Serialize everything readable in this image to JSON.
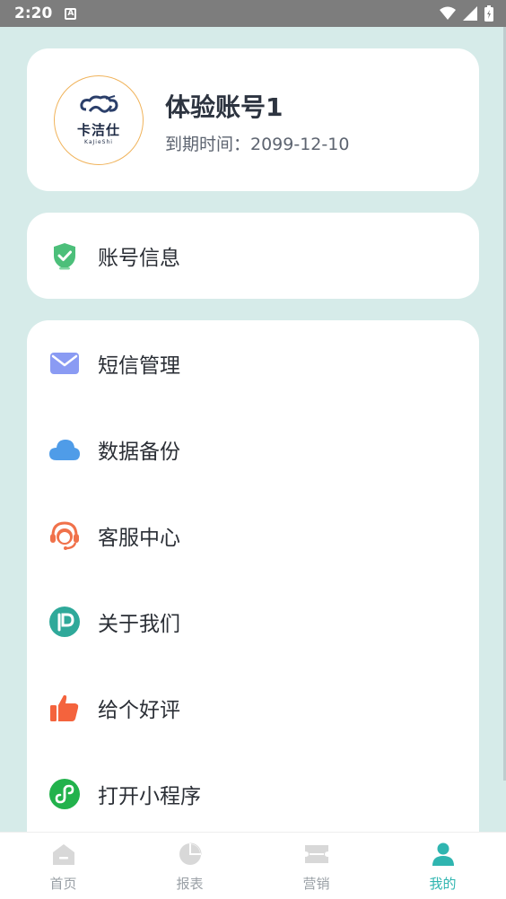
{
  "statusbar": {
    "time": "2:20",
    "a_icon": "A"
  },
  "profile": {
    "name": "体验账号1",
    "expire": "到期时间：2099-12-10",
    "brand_cn": "卡洁仕",
    "brand_en": "KaJieShi"
  },
  "account": {
    "label": "账号信息",
    "icon": "shield-check-icon",
    "color": "#4cbf7a"
  },
  "menu": {
    "items": [
      {
        "label": "短信管理",
        "icon": "mail-icon",
        "color": "#8a9bf3"
      },
      {
        "label": "数据备份",
        "icon": "cloud-icon",
        "color": "#4f9ce8"
      },
      {
        "label": "客服中心",
        "icon": "headset-icon",
        "color": "#f0714a"
      },
      {
        "label": "关于我们",
        "icon": "about-icon",
        "color": "#2fa99a"
      },
      {
        "label": "给个好评",
        "icon": "thumbs-up-icon",
        "color": "#f4633d"
      },
      {
        "label": "打开小程序",
        "icon": "mini-program-icon",
        "color": "#22b24c"
      }
    ]
  },
  "tabbar": {
    "tabs": [
      {
        "label": "首页",
        "icon": "home-icon"
      },
      {
        "label": "报表",
        "icon": "pie-chart-icon"
      },
      {
        "label": "营销",
        "icon": "ticket-icon"
      },
      {
        "label": "我的",
        "icon": "user-icon",
        "active": true
      }
    ],
    "active_color": "#2fb5b0",
    "inactive_color": "#d8d8d8"
  }
}
